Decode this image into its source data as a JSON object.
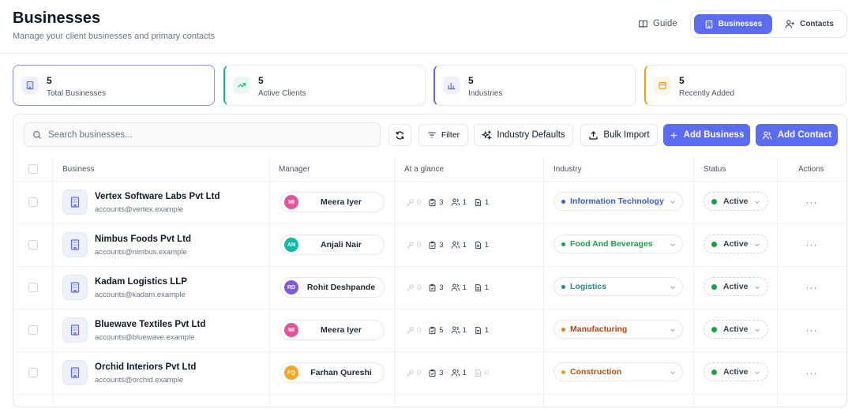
{
  "header": {
    "title": "Businesses",
    "subtitle": "Manage your client businesses and primary contacts",
    "guide_label": "Guide",
    "tabs": [
      {
        "label": "Businesses",
        "active": true
      },
      {
        "label": "Contacts",
        "active": false
      }
    ]
  },
  "stats": [
    {
      "value": "5",
      "label": "Total Businesses",
      "icon": "building-icon",
      "accent": "#5b6cf0"
    },
    {
      "value": "5",
      "label": "Active Clients",
      "icon": "trending-up-icon",
      "accent": "#10b981"
    },
    {
      "value": "5",
      "label": "Industries",
      "icon": "bar-chart-icon",
      "accent": "#6366f1"
    },
    {
      "value": "5",
      "label": "Recently Added",
      "icon": "calendar-icon",
      "accent": "#f59e0b"
    }
  ],
  "toolbar": {
    "search_placeholder": "Search businesses...",
    "filter_label": "Filter",
    "industry_defaults_label": "Industry Defaults",
    "bulk_import_label": "Bulk Import",
    "add_business_label": "Add Business",
    "add_contact_label": "Add Contact"
  },
  "table": {
    "columns": [
      "Business",
      "Manager",
      "At a glance",
      "Industry",
      "Status",
      "Actions"
    ],
    "rows": [
      {
        "name": "Vertex Software Labs Pvt Ltd",
        "email": "accounts@vertex.example",
        "manager": "Meera Iyer",
        "initials": "MI",
        "avatar_color": "#e0569b",
        "glance": [
          "0",
          "3",
          "1",
          "1"
        ],
        "industry": "Information Technology",
        "industry_color": "#3b5bdb",
        "status": "Active"
      },
      {
        "name": "Nimbus Foods Pvt Ltd",
        "email": "accounts@nimbus.example",
        "manager": "Anjali Nair",
        "initials": "AN",
        "avatar_color": "#14b8a6",
        "glance": [
          "0",
          "3",
          "1",
          "1"
        ],
        "industry": "Food And Beverages",
        "industry_color": "#16a34a",
        "status": "Active"
      },
      {
        "name": "Kadam Logistics LLP",
        "email": "accounts@kadam.example",
        "manager": "Rohit Deshpande",
        "initials": "RD",
        "avatar_color": "#7c5cd6",
        "glance": [
          "0",
          "3",
          "1",
          "1"
        ],
        "industry": "Logistics",
        "industry_color": "#0d9488",
        "status": "Active"
      },
      {
        "name": "Bluewave Textiles Pvt Ltd",
        "email": "accounts@bluewave.example",
        "manager": "Meera Iyer",
        "initials": "MI",
        "avatar_color": "#e0569b",
        "glance": [
          "0",
          "5",
          "1",
          "1"
        ],
        "industry": "Manufacturing",
        "industry_color": "#c2410c",
        "status": "Active"
      },
      {
        "name": "Orchid Interiors Pvt Ltd",
        "email": "accounts@orchid.example",
        "manager": "Farhan Qureshi",
        "initials": "FQ",
        "avatar_color": "#f5a623",
        "glance": [
          "0",
          "3",
          "1",
          "0"
        ],
        "industry": "Construction",
        "industry_color": "#b45309",
        "status": "Active"
      }
    ]
  },
  "colors": {
    "primary": "#5b6cf0",
    "active_dot": "#16a34a"
  }
}
